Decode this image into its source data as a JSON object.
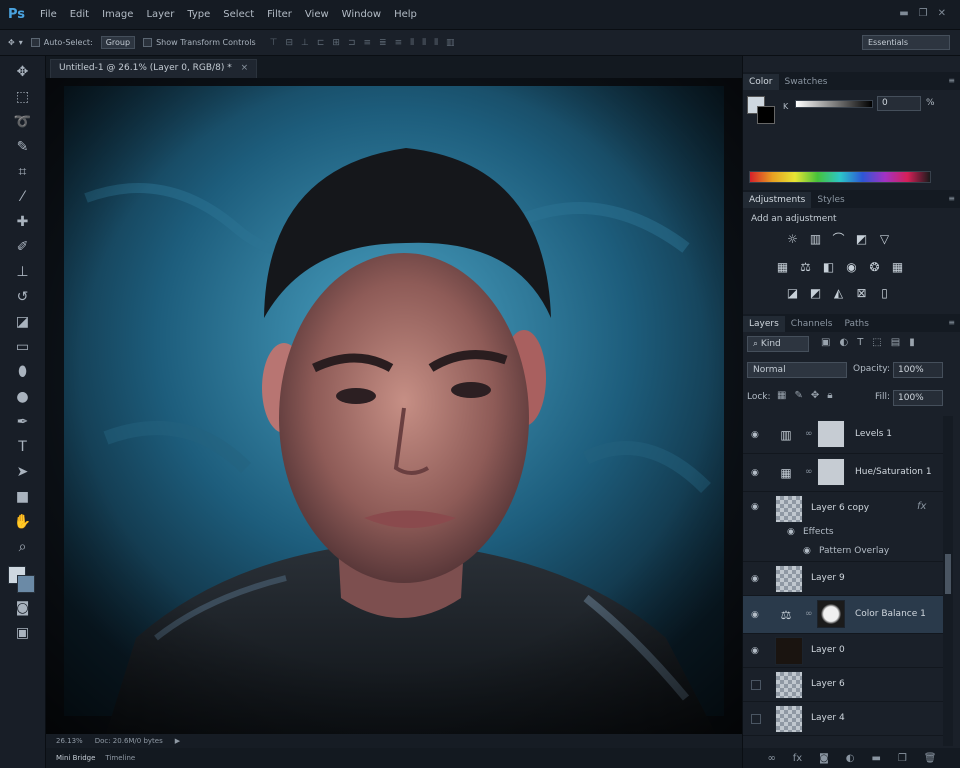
{
  "app": {
    "logo": "Ps"
  },
  "menu": [
    "File",
    "Edit",
    "Image",
    "Layer",
    "Type",
    "Select",
    "Filter",
    "View",
    "Window",
    "Help"
  ],
  "options": {
    "auto_select_label": "Auto-Select:",
    "auto_select_value": "Group",
    "show_transform_label": "Show Transform Controls",
    "workspace": "Essentials"
  },
  "document": {
    "tab_title": "Untitled-1 @ 26.1% (Layer 0, RGB/8) *",
    "zoom": "26.13%",
    "doc_info": "Doc: 20.6M/0 bytes",
    "bottom_tabs": [
      "Mini Bridge",
      "Timeline"
    ]
  },
  "color_panel": {
    "tabs": [
      "Color",
      "Swatches"
    ],
    "k_label": "K",
    "k_value": "0",
    "k_unit": "%",
    "colors": {
      "foreground": "#cfd8e0",
      "background": "#000000"
    }
  },
  "adjustments_panel": {
    "tabs": [
      "Adjustments",
      "Styles"
    ],
    "title": "Add an adjustment",
    "rows": [
      [
        "brightness-contrast-icon",
        "levels-icon",
        "curves-icon",
        "exposure-icon",
        "vibrance-icon"
      ],
      [
        "hue-saturation-icon",
        "color-balance-icon",
        "black-white-icon",
        "photo-filter-icon",
        "channel-mixer-icon",
        "color-lookup-icon"
      ],
      [
        "invert-icon",
        "posterize-icon",
        "threshold-icon",
        "selective-color-icon",
        "gradient-map-icon"
      ]
    ]
  },
  "layers_panel": {
    "tabs": [
      "Layers",
      "Channels",
      "Paths"
    ],
    "kind_label": "Kind",
    "blend_mode": "Normal",
    "opacity_label": "Opacity:",
    "opacity_value": "100%",
    "lock_label": "Lock:",
    "fill_label": "Fill:",
    "fill_value": "100%",
    "layers": [
      {
        "name": "Levels 1",
        "type": "adjustment",
        "icon": "levels-icon",
        "visible": true
      },
      {
        "name": "Hue/Saturation 1",
        "type": "adjustment",
        "icon": "hue-saturation-icon",
        "visible": true
      },
      {
        "name": "Layer 6 copy",
        "type": "pixel",
        "visible": true,
        "fx": "fx",
        "effects_label": "Effects",
        "effect": "Pattern Overlay"
      },
      {
        "name": "Layer 9",
        "type": "pixel",
        "visible": true
      },
      {
        "name": "Color Balance 1",
        "type": "adjustment",
        "icon": "color-balance-icon",
        "visible": true,
        "selected": true
      },
      {
        "name": "Layer 0",
        "type": "photo",
        "visible": true
      },
      {
        "name": "Layer 6",
        "type": "pixel",
        "visible": false
      },
      {
        "name": "Layer 4",
        "type": "pixel",
        "visible": false
      }
    ]
  }
}
